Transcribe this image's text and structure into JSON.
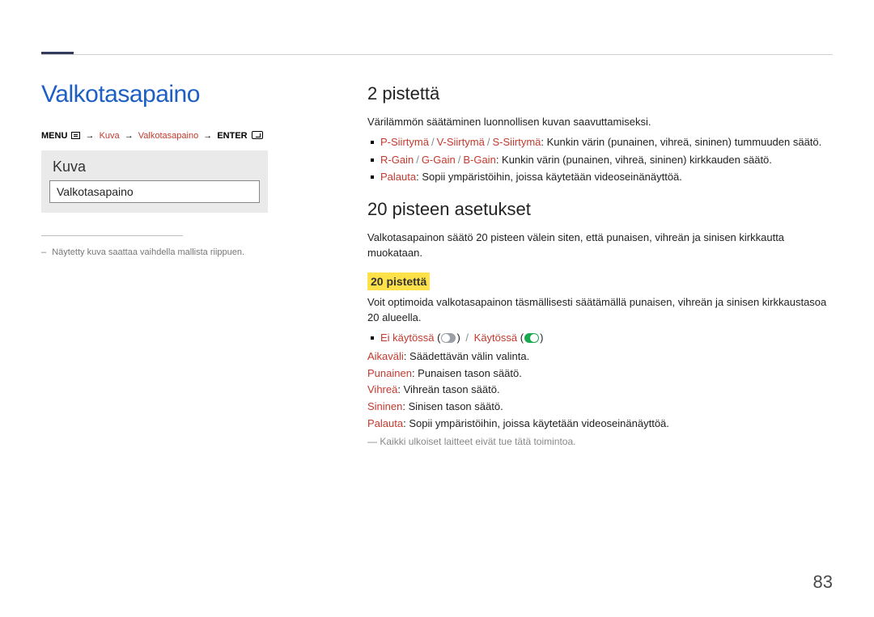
{
  "page_number": "83",
  "left": {
    "title": "Valkotasapaino",
    "breadcrumb": {
      "menu": "MENU",
      "arrow": "→",
      "kuva": "Kuva",
      "valko": "Valkotasapaino",
      "enter": "ENTER"
    },
    "panel": {
      "heading": "Kuva",
      "row": "Valkotasapaino"
    },
    "footnote": "Näytetty kuva saattaa vaihdella mallista riippuen."
  },
  "right": {
    "sec1": {
      "heading": "2 pistettä",
      "intro": "Värilämmön säätäminen luonnollisen kuvan saavuttamiseksi.",
      "b1": {
        "p": "P-Siirtymä",
        "v": "V-Siirtymä",
        "s": "S-Siirtymä",
        "rest": ": Kunkin värin (punainen, vihreä, sininen) tummuuden säätö."
      },
      "b2": {
        "r": "R-Gain",
        "g": "G-Gain",
        "b": "B-Gain",
        "rest": ": Kunkin värin (punainen, vihreä, sininen) kirkkauden säätö."
      },
      "b3": {
        "lbl": "Palauta",
        "rest": ": Sopii ympäristöihin, joissa käytetään videoseinänäyttöä."
      }
    },
    "sec2": {
      "heading": "20 pisteen asetukset",
      "intro": "Valkotasapainon säätö 20 pisteen välein siten, että punaisen, vihreän ja sinisen kirkkautta muokataan.",
      "sub": "20 pistettä",
      "desc": "Voit optimoida valkotasapainon täsmällisesti säätämällä punaisen, vihreän ja sinisen kirkkaustasoa 20 alueella.",
      "toggle": {
        "off": "Ei käytössä",
        "on": "Käytössä"
      },
      "lines": {
        "aikavali": {
          "lbl": "Aikaväli",
          "txt": ": Säädettävän välin valinta."
        },
        "punainen": {
          "lbl": "Punainen",
          "txt": ": Punaisen tason säätö."
        },
        "vihrea": {
          "lbl": "Vihreä",
          "txt": ": Vihreän tason säätö."
        },
        "sininen": {
          "lbl": "Sininen",
          "txt": ": Sinisen tason säätö."
        },
        "palauta": {
          "lbl": "Palauta",
          "txt": ": Sopii ympäristöihin, joissa käytetään videoseinänäyttöä."
        }
      },
      "note_prefix": "―",
      "note": "Kaikki ulkoiset laitteet eivät tue tätä toimintoa."
    }
  }
}
